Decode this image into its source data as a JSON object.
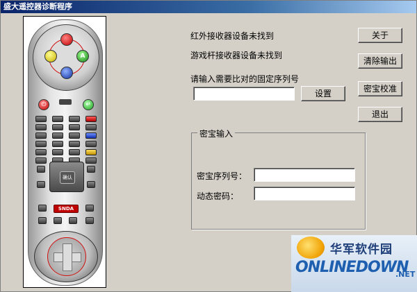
{
  "window": {
    "title": "盛大遥控器诊断程序"
  },
  "status": {
    "ir_receiver": "红外接收器设备未找到",
    "gamepad_receiver": "游戏杆接收器设备未找到"
  },
  "serial": {
    "prompt": "请输入需要比对的固定序列号",
    "value": "",
    "set_label": "设置"
  },
  "buttons": {
    "about": "关于",
    "clear_output": "清除输出",
    "calibrate": "密宝校准",
    "exit": "退出"
  },
  "mibao": {
    "group_label": "密宝输入",
    "serial_label": "密宝序列号：",
    "serial_value": "",
    "password_label": "动态密码：",
    "password_value": ""
  },
  "remote": {
    "gamepad_buttons": [
      "",
      "",
      "A",
      ""
    ],
    "ok_label": "确认",
    "logo": "SNDA"
  },
  "watermark": {
    "cn": "华军软件园",
    "en": "ONLINEDOWN",
    "suffix": ".NET"
  }
}
